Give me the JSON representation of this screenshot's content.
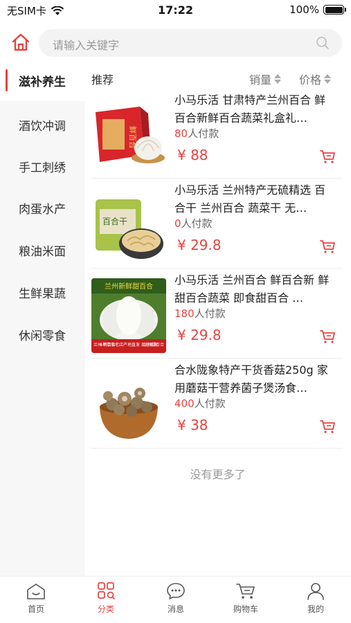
{
  "status_bar": {
    "carrier": "无SIM卡",
    "time": "17:22",
    "battery": "100%"
  },
  "search": {
    "placeholder": "请输入关键字"
  },
  "categories": [
    {
      "label": "滋补养生",
      "active": true
    },
    {
      "label": "酒饮冲调",
      "active": false
    },
    {
      "label": "手工刺绣",
      "active": false
    },
    {
      "label": "肉蛋水产",
      "active": false
    },
    {
      "label": "粮油米面",
      "active": false
    },
    {
      "label": "生鲜果蔬",
      "active": false
    },
    {
      "label": "休闲零食",
      "active": false
    }
  ],
  "sort": {
    "recommend": "推荐",
    "sales": "销量",
    "price": "价格"
  },
  "products": [
    {
      "title": "小马乐活 甘肃特产兰州百合 鲜百合新鲜百合蔬菜礼盒礼…",
      "buyers": "80",
      "buyers_suffix": "人付款",
      "price": "¥ 88"
    },
    {
      "title": "小马乐活 兰州特产无硫精选 百合干 兰州百合 蔬菜干 无…",
      "buyers": "0",
      "buyers_suffix": "人付款",
      "price": "¥ 29.8"
    },
    {
      "title": "小马乐活 兰州百合 鲜百合新 鲜甜百合蔬菜 即食甜百合 …",
      "buyers": "180",
      "buyers_suffix": "人付款",
      "price": "¥ 29.8"
    },
    {
      "title": "合水陇象特产干货香菇250g 家用蘑菇干营养菌子煲汤食…",
      "buyers": "400",
      "buyers_suffix": "人付款",
      "price": "¥ 38"
    }
  ],
  "thumbnail_texts": {
    "p1_box": "鲜百合",
    "p2_bag": "百合干",
    "p3_banner": "兰州新鲜甜百合",
    "p3_footer_left": "兰州 鲜百合",
    "p3_footer_mid": "6年京东老店产地直发 现挖现发",
    "p3_footer_right": "兰州甜百合"
  },
  "no_more": "没有更多了",
  "tabs": [
    {
      "label": "首页",
      "icon": "home-icon"
    },
    {
      "label": "分类",
      "icon": "category-icon"
    },
    {
      "label": "消息",
      "icon": "message-icon"
    },
    {
      "label": "购物车",
      "icon": "cart-icon"
    },
    {
      "label": "我的",
      "icon": "profile-icon"
    }
  ],
  "colors": {
    "accent": "#e64340",
    "sidebar_bg": "#f7f7f7",
    "search_bg": "#f3f3f3"
  }
}
